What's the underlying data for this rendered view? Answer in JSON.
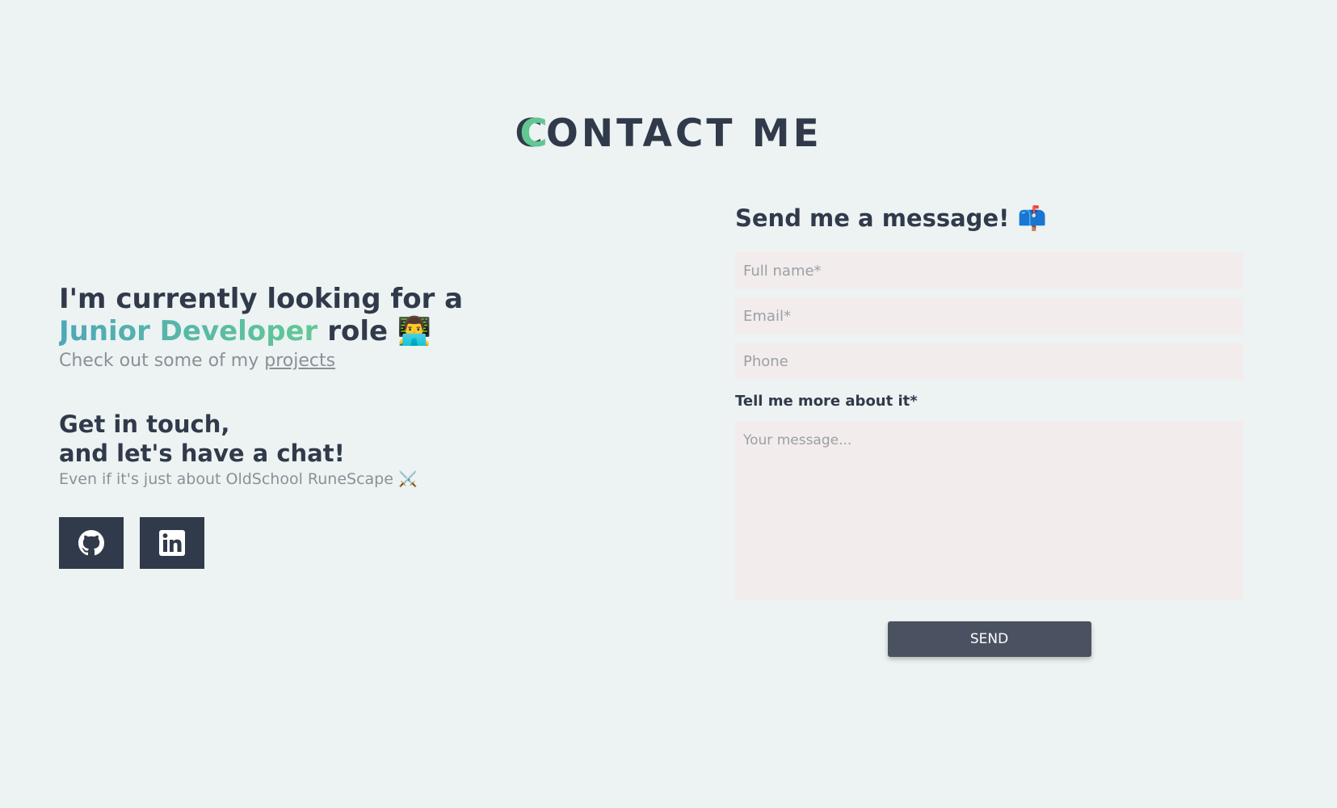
{
  "page": {
    "title_first": "C",
    "title_rest": "ONTACT ME"
  },
  "intro": {
    "line1": "I'm currently looking for a",
    "highlight": "Junior Developer",
    "role_word": "role",
    "role_emoji": "👨‍💻",
    "sub_prefix": "Check out some of my",
    "sub_link": "projects"
  },
  "touch": {
    "line1": "Get in touch,",
    "line2": "and let's have a chat!",
    "sub": "Even if it's just about OldSchool RuneScape",
    "sub_emoji": "⚔️"
  },
  "socials": [
    {
      "name": "GitHub",
      "icon": "github-icon"
    },
    {
      "name": "LinkedIn",
      "icon": "linkedin-icon"
    }
  ],
  "form": {
    "title": "Send me a message!",
    "title_emoji": "📫",
    "fullname_placeholder": "Full name*",
    "email_placeholder": "Email*",
    "phone_placeholder": "Phone",
    "message_label": "Tell me more about it*",
    "message_placeholder": "Your message...",
    "send_label": "SEND"
  },
  "colors": {
    "background": "#ecf3f2",
    "text": "#313a4b",
    "accent_start": "#4fa7b7",
    "accent_end": "#61c996",
    "field_bg": "#f3ecec",
    "button_bg": "#4a5261"
  }
}
